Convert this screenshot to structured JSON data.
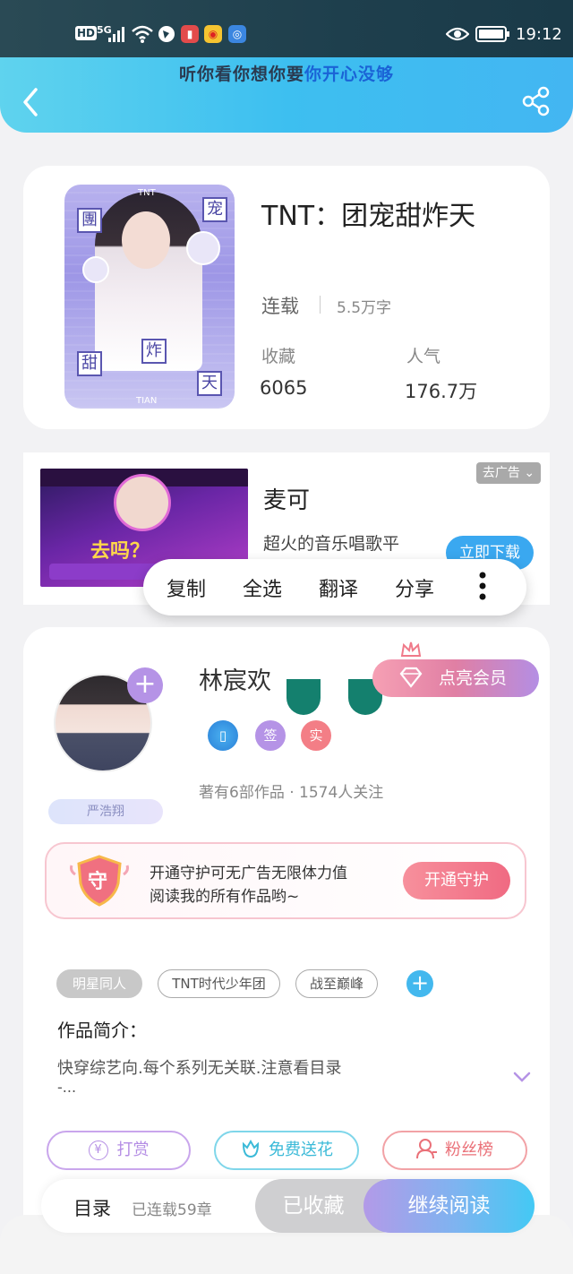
{
  "status_bar": {
    "hd": "HD",
    "signal": "5G",
    "time": "19:12"
  },
  "banner_text_a": "听你看你想你要",
  "banner_text_b": "你开心没够",
  "book": {
    "title": "TNT：团宠甜炸天",
    "serial_status": "连载",
    "word_count": "5.5万字",
    "fav_label": "收藏",
    "fav_value": "6065",
    "pop_label": "人气",
    "pop_value": "176.7万",
    "cover_chars": [
      "團",
      "宠",
      "甜",
      "炸",
      "天"
    ],
    "cover_brand": "TNT",
    "cover_brand_bottom": "TIAN"
  },
  "ad": {
    "remove_label": "去广告",
    "title": "麦可",
    "desc_line1": "超火的音乐唱歌平",
    "download_label": "立即下载",
    "img_text": "去吗？"
  },
  "context_menu": [
    "复制",
    "全选",
    "翻译",
    "分享"
  ],
  "author": {
    "name": "林宸欢",
    "badges": [
      "签",
      "实"
    ],
    "stats": "著有6部作品 · 1574人关注",
    "fan_label": "严浩翔",
    "vip_label": "点亮会员"
  },
  "guard": {
    "icon_char": "守",
    "line1": "开通守护可无广告无限体力值",
    "line2": "阅读我的所有作品哟~",
    "button": "开通守护"
  },
  "tags": [
    "明星同人",
    "TNT时代少年团",
    "战至巅峰"
  ],
  "intro": {
    "heading": "作品简介：",
    "text": "快穿综艺向.每个系列无关联.注意看目录",
    "more": "-..."
  },
  "actions": {
    "tip": "打赏",
    "flower": "免费送花",
    "fans": "粉丝榜"
  },
  "bottom": {
    "catalog": "目录",
    "chapters": "已连载59章",
    "collected": "已收藏",
    "continue": "继续阅读"
  },
  "colors": {
    "header_accent": "#3dbff0",
    "purple": "#a98ef0",
    "pink": "#f07a8a",
    "teal": "#14806e"
  }
}
